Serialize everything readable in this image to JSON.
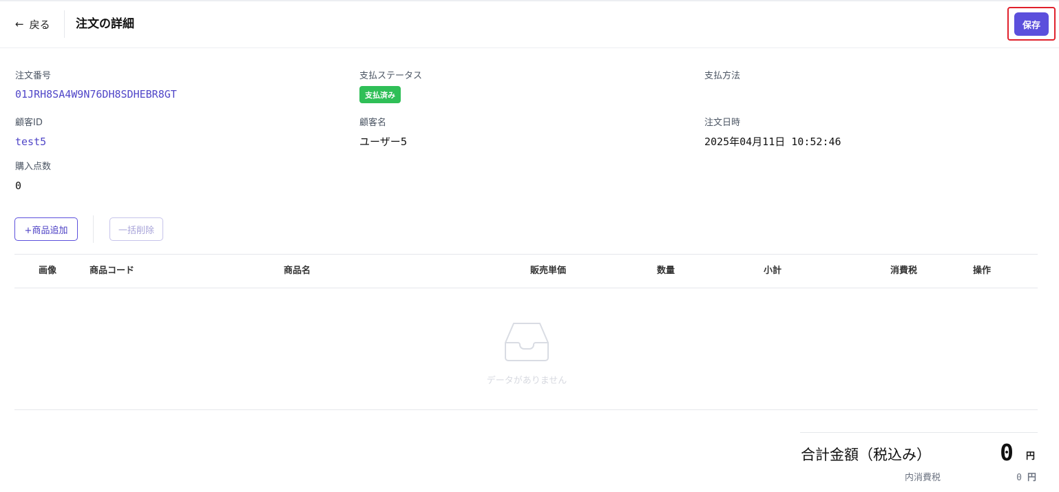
{
  "header": {
    "back_label": "戻る",
    "back_icon": "arrow-left-icon",
    "title": "注文の詳細",
    "save_label": "保存"
  },
  "order": {
    "order_number_label": "注文番号",
    "order_number": "01JRH8SA4W9N76DH8SDHEBR8GT",
    "payment_status_label": "支払ステータス",
    "payment_status": "支払済み",
    "payment_status_color": "#2fbf57",
    "payment_method_label": "支払方法",
    "payment_method": "",
    "customer_id_label": "顧客ID",
    "customer_id": "test5",
    "customer_name_label": "顧客名",
    "customer_name": "ユーザー5",
    "order_date_label": "注文日時",
    "order_date": "2025年04月11日 10:52:46",
    "item_count_label": "購入点数",
    "item_count": "0"
  },
  "actions": {
    "add_item_label": "+商品追加",
    "bulk_delete_label": "一括削除"
  },
  "table": {
    "columns": [
      "画像",
      "商品コード",
      "商品名",
      "販売単価",
      "数量",
      "小計",
      "消費税",
      "操作"
    ],
    "rows": [],
    "empty_icon": "inbox-icon",
    "empty_text": "データがありません"
  },
  "totals": {
    "total_label": "合計金額（税込み）",
    "total_value": "0",
    "total_unit": "円",
    "tax_label": "内消費税",
    "tax_value": "0",
    "tax_unit": "円"
  },
  "colors": {
    "primary": "#5b4fdc",
    "highlight": "#e0202b",
    "link": "#5046c8"
  }
}
